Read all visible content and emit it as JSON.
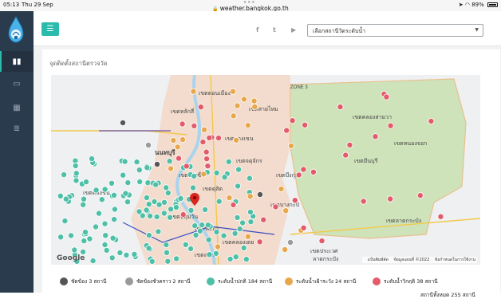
{
  "status_bar": {
    "time": "05:13",
    "date": "Thu 29 Sep",
    "url": "weather.bangkok.go.th",
    "battery": "89%"
  },
  "header": {
    "station_select": {
      "selected": "เลือกสถานีวัดระดับน้ำ"
    },
    "social": {
      "facebook": "f",
      "twitter": "t",
      "youtube": "▶"
    }
  },
  "sidebar": {
    "items": [
      {
        "icon": "bar-chart-icon"
      },
      {
        "icon": "bed-icon"
      },
      {
        "icon": "table-icon"
      },
      {
        "icon": "database-icon"
      }
    ]
  },
  "main": {
    "title": "จุดติดตั้งสถานีตรวจวัด",
    "map": {
      "provider": "Google",
      "attribution": {
        "shortcuts": "แป้นพิมพ์ลัด",
        "map_data": "ข้อมูลแผนที่ ©2022",
        "terms": "ข้อกำหนดในการใช้งาน"
      },
      "place_labels": [
        "เขตดอนเมือง",
        "เขตสายไหม",
        "เขตบางเขน",
        "เขตหลักสี่",
        "เขตคลองสามวา",
        "เขตหนองจอก",
        "เขตมีนบุรี",
        "เขตลาดกระบัง",
        "เขตประเวศ",
        "เขตบางกะปิ",
        "เขตจตุจักร",
        "เขตบึงกุ่ม",
        "เขตปทุมวัน",
        "เขตวัฒนา",
        "เขตคลองเตย",
        "เขตสาทร",
        "เขตบางซื่อ",
        "เขตดุสิต",
        "นนทบุรี",
        "ลาดกระบัง",
        "เขตตลิ่งชัน",
        "ZONE 3"
      ],
      "colors": {
        "normal": "#4fbfa8",
        "watch": "#e9a74c",
        "critical": "#e35b6b",
        "maintenance": "#9a9a9a",
        "broken": "#555555",
        "water": "#a9d4ee",
        "land": "#e9ecee",
        "urban": "#f1d7c7",
        "green": "#c9e1b3"
      }
    },
    "legend": [
      {
        "key": "broken",
        "label": "ชัดข้อง 3 สถานี",
        "color": "#555555"
      },
      {
        "key": "maintenance",
        "label": "ชัดข้องชั่วคราว 2 สถานี",
        "color": "#9a9a9a"
      },
      {
        "key": "normal",
        "label": "ระดับน้ำปกติ 184 สถานี",
        "color": "#4fbfa8"
      },
      {
        "key": "watch",
        "label": "ระดับน้ำเฝ้าระวัง 24 สถานี",
        "color": "#e9a74c"
      },
      {
        "key": "critical",
        "label": "ระดับน้ำวิกฤติ 38 สถานี",
        "color": "#e35b6b"
      }
    ],
    "total": "สถานีทั้งหมด 255 สถานี"
  }
}
